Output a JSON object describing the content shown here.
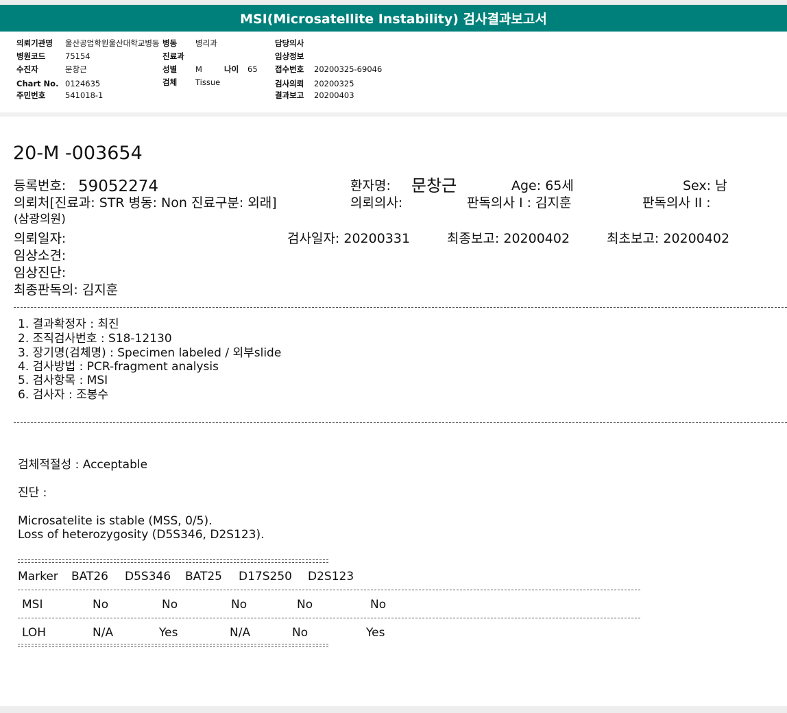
{
  "title": "MSI(Microsatellite Instability) 검사결과보고서",
  "header": {
    "requesting_org_label": "의뢰기관명",
    "requesting_org_value": "울산공업학원울산대학교병동",
    "ward_label": "병동",
    "ward_value": "병리과",
    "doctor_label": "담당의사",
    "hospital_code_label": "병원코드",
    "hospital_code_value": "75154",
    "department_label": "진료과",
    "clinical_info_label": "임상정보",
    "patient_label": "수진자",
    "patient_value": "문창근",
    "sex_label": "성별",
    "sex_value": "M",
    "age_label": "나이",
    "age_value": "65",
    "receipt_label": "접수번호",
    "receipt_value": "20200325-69046",
    "chart_label": "Chart No.",
    "chart_value": "0124635",
    "specimen_label": "검체",
    "specimen_value": "Tissue",
    "test_request_label": "검사의뢰",
    "test_request_value": "20200325",
    "id_label": "주민번호",
    "id_value": "541018-1",
    "result_report_label": "결과보고",
    "result_report_value": "20200403"
  },
  "report": {
    "number": "20-M -003654",
    "reg_no_label": "등록번호:",
    "reg_no_value": "59052274",
    "patient_name_label": "환자명:",
    "patient_name_value": "문창근",
    "age_text": "Age:  65세",
    "sex_text": "Sex:   남",
    "requester_line": "의뢰처[진료과: STR 병동: Non 진료구분: 외래]",
    "requesting_doctor": "의뢰의사:",
    "reading_doctor_1": "판독의사 I : 김지훈",
    "reading_doctor_2": "판독의사 II :",
    "clinic_name": "(삼광의원)",
    "request_date": "의뢰일자:",
    "test_date": "검사일자: 20200331",
    "final_report": "최종보고: 20200402",
    "first_report": "최초보고: 20200402",
    "clinical_findings": "임상소견:",
    "clinical_diagnosis": "임상진단:",
    "final_reader": "최종판독의: 김지훈"
  },
  "details": [
    "1. 결과확정자 :   최진",
    "2. 조직검사번호 : S18-12130",
    "3. 장기명(검체명) : Specimen labeled / 외부slide",
    "4. 검사방법 : PCR-fragment analysis",
    "5. 검사항목 : MSI",
    "6. 검사자 : 조봉수"
  ],
  "result": {
    "adequacy": "검체적절성 : Acceptable",
    "diagnosis_label": "진단 :",
    "line1": "Microsatelite is stable (MSS, 0/5).",
    "line2": "Loss of heterozygosity (D5S346, D2S123)."
  },
  "marker_table": {
    "header": [
      "Marker",
      "BAT26",
      "D5S346",
      "BAT25",
      "D17S250",
      "D2S123"
    ],
    "rows": [
      [
        "MSI",
        "No",
        "No",
        "No",
        "No",
        "No"
      ],
      [
        "LOH",
        "N/A",
        "Yes",
        "N/A",
        "No",
        "Yes"
      ]
    ]
  }
}
